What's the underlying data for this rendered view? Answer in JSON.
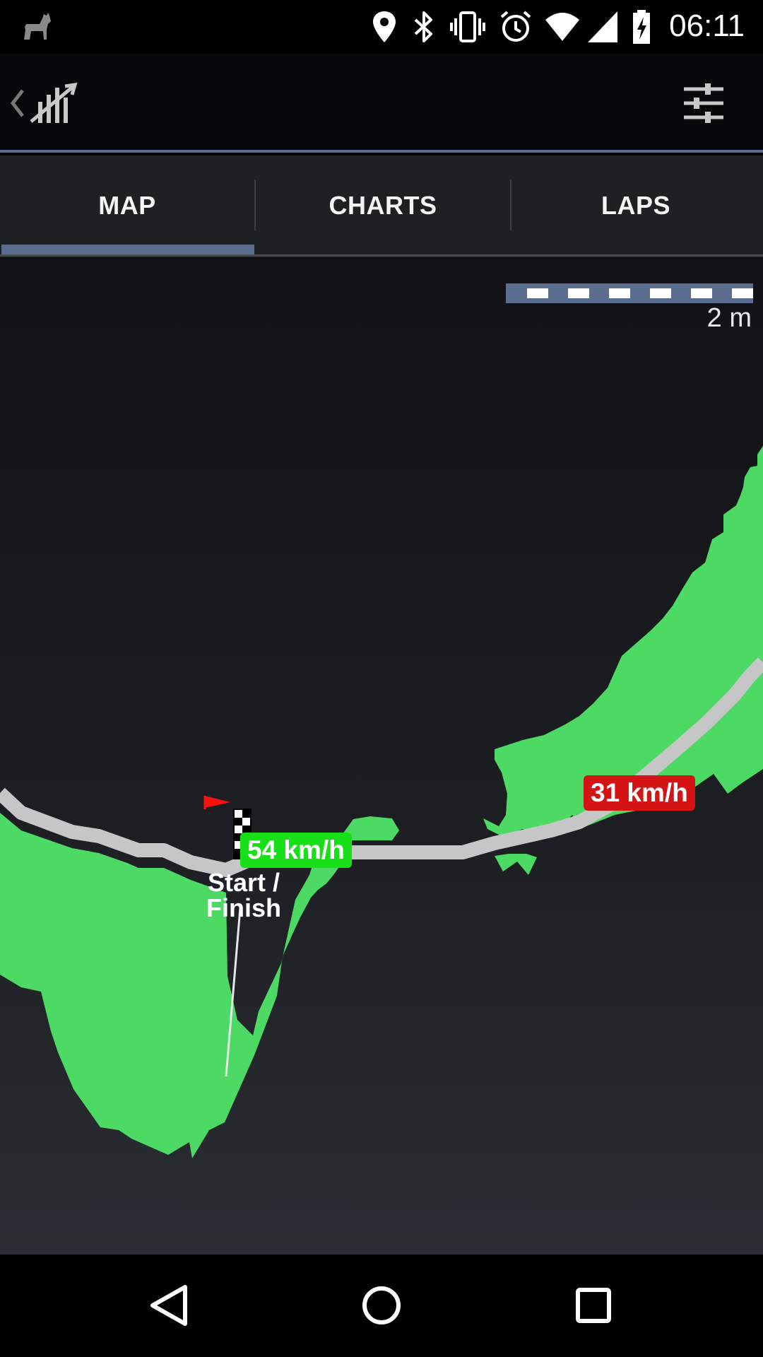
{
  "status_bar": {
    "time": "06:11",
    "icons": [
      "app-notification-icon",
      "location-icon",
      "bluetooth-icon",
      "vibrate-icon",
      "alarm-icon",
      "wifi-icon",
      "cell-signal-icon",
      "battery-charging-icon"
    ]
  },
  "action_bar": {
    "icons": [
      "back-chevron-icon",
      "app-logo-icon",
      "settings-sliders-icon"
    ]
  },
  "tabs": [
    {
      "label": "MAP",
      "selected": true
    },
    {
      "label": "CHARTS",
      "selected": false
    },
    {
      "label": "LAPS",
      "selected": false
    }
  ],
  "map": {
    "scale_label": "2 m",
    "max_speed_label": "54 km/h",
    "min_speed_label": "31 km/h",
    "start_finish_label_line1": "Start /",
    "start_finish_label_line2": "Finish",
    "colors": {
      "track": "#c6c6c6",
      "speed_area": "#4cd964",
      "max_speed_badge": "#18e018",
      "min_speed_badge": "#d41414",
      "flag": "#ff1010",
      "scale_bar": "#5a6d8f"
    }
  },
  "nav_bar": {
    "icons": [
      "back-triangle-icon",
      "home-circle-icon",
      "recents-square-icon"
    ]
  }
}
